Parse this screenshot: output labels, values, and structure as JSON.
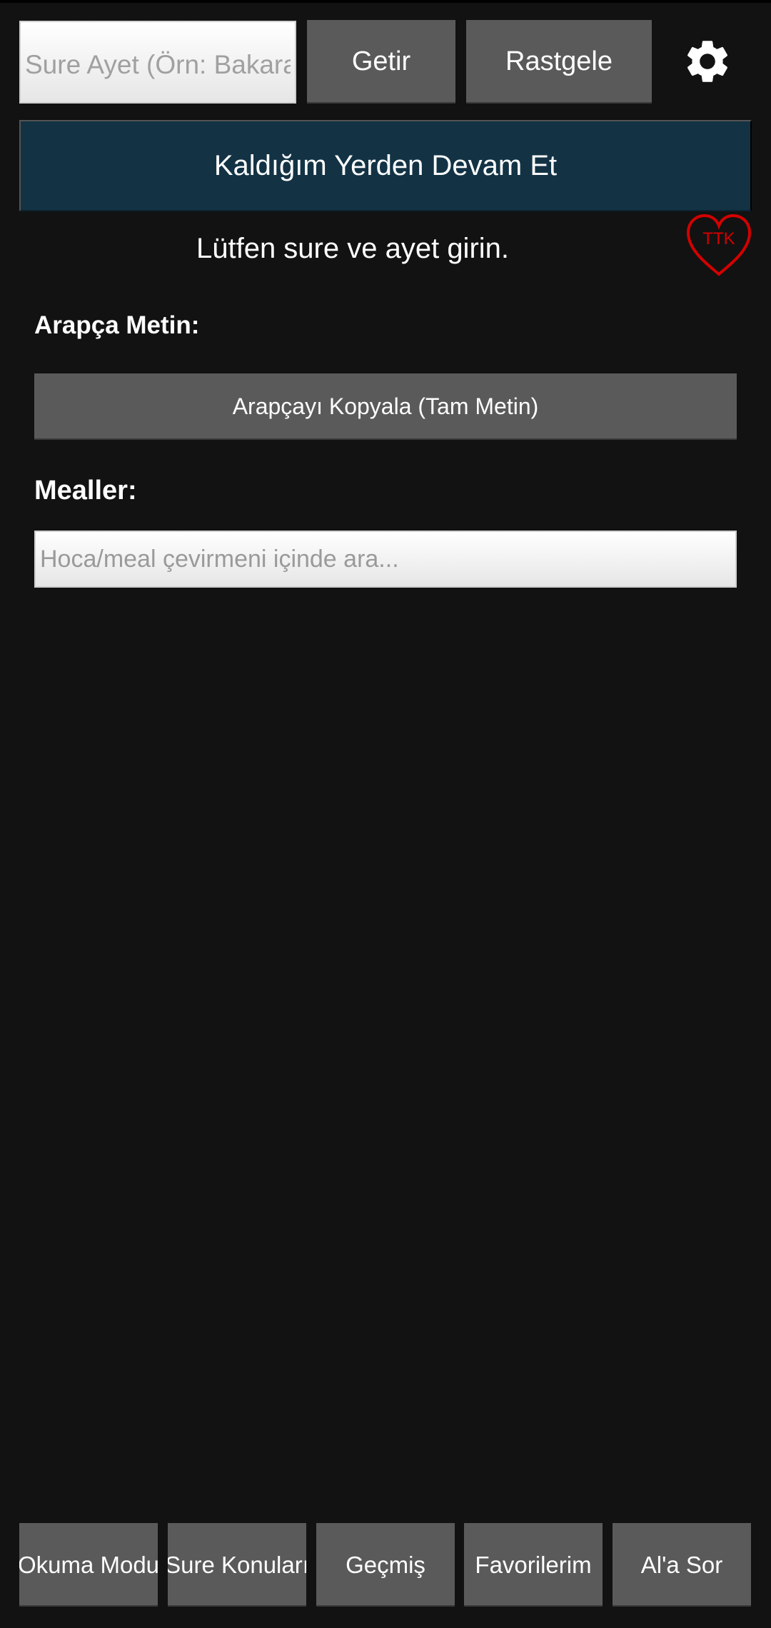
{
  "header": {
    "search_placeholder": "Sure Ayet (Örn: Bakara",
    "getir_label": "Getir",
    "rastgele_label": "Rastgele",
    "settings_icon": "gear-icon"
  },
  "resume": {
    "label": "Kaldığım Yerden Devam Et"
  },
  "badge": {
    "text": "TTK",
    "icon": "heart-icon",
    "color": "#d40000"
  },
  "status": {
    "message": "Lütfen sure ve ayet girin."
  },
  "arabic": {
    "heading": "Arapça Metin:",
    "copy_label": "Arapçayı Kopyala (Tam Metin)"
  },
  "meals": {
    "heading": "Mealler:",
    "search_placeholder": "Hoca/meal çevirmeni içinde ara..."
  },
  "bottom_nav": {
    "items": [
      {
        "label": "Okuma Modu"
      },
      {
        "label": "Sure Konuları"
      },
      {
        "label": "Geçmiş"
      },
      {
        "label": "Favorilerim"
      },
      {
        "label": "Al'a Sor"
      }
    ]
  },
  "colors": {
    "background": "#121212",
    "button": "#5a5a5a",
    "resume_bg": "#133345",
    "heart": "#d40000"
  }
}
